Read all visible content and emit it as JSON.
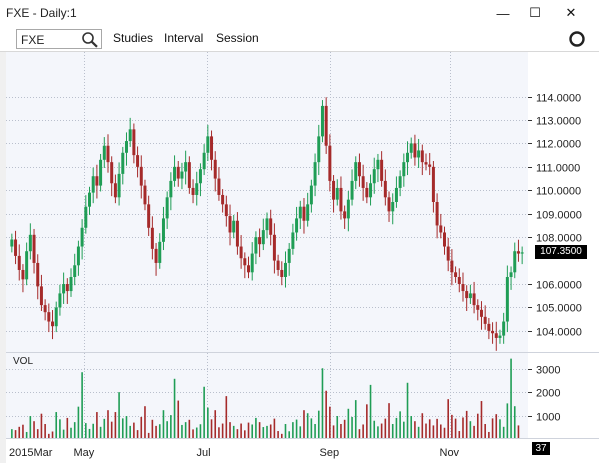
{
  "window": {
    "title": "FXE - Daily:1",
    "minimize_glyph": "—",
    "maximize_glyph": "☐",
    "close_glyph": "✕"
  },
  "toolbar": {
    "symbol": "FXE",
    "menus": [
      "Studies",
      "Interval",
      "Session"
    ],
    "search_icon": "search-icon",
    "settings_icon": "ring-icon"
  },
  "chart_data": {
    "type": "candlestick",
    "title": "",
    "price_ticks": [
      "114.0000",
      "113.0000",
      "112.0000",
      "111.0000",
      "110.0000",
      "109.0000",
      "108.0000",
      "106.0000",
      "105.0000",
      "104.0000"
    ],
    "ylim": [
      103.1,
      115.9
    ],
    "last_price": "107.3500",
    "volume_label": "VOL",
    "volume_ticks": [
      "3000",
      "2000",
      "1000"
    ],
    "volume_ylim": [
      0,
      3500
    ],
    "last_volume": "37",
    "time_ticks": [
      "2015Mar",
      "May",
      "Jul",
      "Sep",
      "Nov"
    ],
    "colors": {
      "up": "#1f9d55",
      "down": "#a52a2a",
      "grid": "#b9bfcc",
      "background": "#f4f6fb"
    },
    "closes": [
      107.9,
      107.2,
      106.6,
      106.2,
      107.4,
      108.1,
      106.9,
      105.9,
      105.1,
      104.8,
      104.4,
      104.2,
      105.0,
      105.6,
      106.0,
      105.7,
      106.3,
      106.8,
      107.6,
      108.4,
      109.3,
      109.9,
      110.6,
      110.2,
      111.3,
      111.9,
      111.2,
      110.3,
      109.7,
      110.7,
      111.6,
      112.1,
      112.6,
      111.5,
      111.0,
      110.2,
      109.4,
      108.4,
      107.5,
      106.9,
      107.8,
      108.8,
      109.7,
      110.4,
      111.0,
      110.5,
      110.8,
      111.2,
      110.1,
      109.8,
      110.3,
      110.9,
      111.6,
      112.3,
      111.3,
      110.5,
      109.8,
      109.4,
      108.9,
      108.2,
      108.7,
      107.6,
      107.1,
      106.8,
      106.5,
      107.3,
      108.0,
      107.7,
      108.3,
      108.8,
      108.1,
      107.0,
      106.6,
      106.3,
      106.9,
      107.5,
      108.2,
      108.8,
      109.3,
      108.7,
      109.4,
      110.2,
      111.2,
      112.3,
      113.6,
      111.9,
      110.4,
      109.6,
      110.1,
      109.1,
      108.8,
      109.6,
      110.4,
      111.2,
      110.6,
      110.1,
      109.7,
      110.3,
      110.9,
      111.3,
      110.4,
      109.7,
      109.1,
      109.5,
      110.1,
      110.6,
      111.2,
      111.6,
      112.0,
      111.4,
      111.7,
      111.2,
      111.1,
      111.0,
      109.5,
      108.5,
      108.2,
      107.6,
      107.0,
      106.5,
      106.3,
      106.0,
      105.7,
      105.4,
      105.6,
      105.1,
      104.9,
      104.6,
      104.3,
      104.0,
      103.9,
      103.7,
      103.8,
      104.4,
      106.3,
      106.5,
      107.4,
      107.3,
      107.35
    ],
    "volumes": [
      420,
      380,
      520,
      610,
      300,
      980,
      760,
      420,
      1080,
      640,
      220,
      320,
      1150,
      840,
      400,
      900,
      480,
      720,
      1380,
      2850,
      680,
      430,
      650,
      1150,
      520,
      860,
      1230,
      740,
      1150,
      2000,
      880,
      980,
      560,
      700,
      380,
      940,
      1400,
      260,
      820,
      560,
      630,
      1230,
      760,
      1020,
      2570,
      1640,
      600,
      720,
      820,
      410,
      490,
      630,
      2230,
      1340,
      840,
      1230,
      500,
      660,
      1830,
      720,
      560,
      420,
      660,
      370,
      700,
      620,
      900,
      720,
      510,
      560,
      620,
      870,
      340,
      220,
      640,
      330,
      720,
      830,
      540,
      1230,
      1100,
      880,
      640,
      1210,
      3020,
      2060,
      1380,
      580,
      980,
      640,
      820,
      1290,
      940,
      1660,
      420,
      620,
      1480,
      2310,
      780,
      540,
      660,
      870,
      1530,
      640,
      900,
      1180,
      740,
      2400,
      980,
      760,
      520,
      1100,
      660,
      840,
      580,
      860,
      620,
      480,
      1700,
      1030,
      870,
      340,
      920,
      1200,
      760,
      560,
      1080,
      1620,
      640,
      300,
      880,
      1060,
      840,
      520,
      1520,
      3430,
      1400,
      580,
      37
    ]
  }
}
